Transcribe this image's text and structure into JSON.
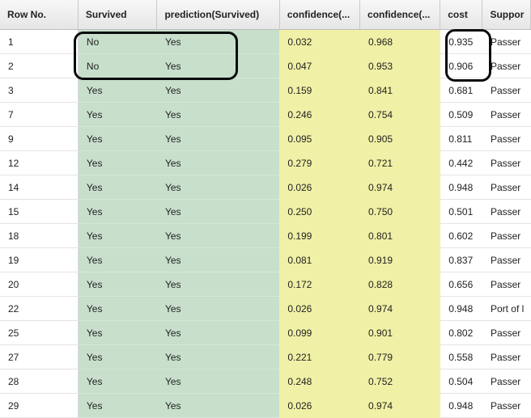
{
  "columns": [
    "Row No.",
    "Survived",
    "prediction(Survived)",
    "confidence(...",
    "confidence(...",
    "cost",
    "Suppor"
  ],
  "rows": [
    {
      "row_no": "1",
      "survived": "No",
      "prediction": "Yes",
      "conf_a": "0.032",
      "conf_b": "0.968",
      "cost": "0.935",
      "support": "Passer"
    },
    {
      "row_no": "2",
      "survived": "No",
      "prediction": "Yes",
      "conf_a": "0.047",
      "conf_b": "0.953",
      "cost": "0.906",
      "support": "Passer"
    },
    {
      "row_no": "3",
      "survived": "Yes",
      "prediction": "Yes",
      "conf_a": "0.159",
      "conf_b": "0.841",
      "cost": "0.681",
      "support": "Passer"
    },
    {
      "row_no": "7",
      "survived": "Yes",
      "prediction": "Yes",
      "conf_a": "0.246",
      "conf_b": "0.754",
      "cost": "0.509",
      "support": "Passer"
    },
    {
      "row_no": "9",
      "survived": "Yes",
      "prediction": "Yes",
      "conf_a": "0.095",
      "conf_b": "0.905",
      "cost": "0.811",
      "support": "Passer"
    },
    {
      "row_no": "12",
      "survived": "Yes",
      "prediction": "Yes",
      "conf_a": "0.279",
      "conf_b": "0.721",
      "cost": "0.442",
      "support": "Passer"
    },
    {
      "row_no": "14",
      "survived": "Yes",
      "prediction": "Yes",
      "conf_a": "0.026",
      "conf_b": "0.974",
      "cost": "0.948",
      "support": "Passer"
    },
    {
      "row_no": "15",
      "survived": "Yes",
      "prediction": "Yes",
      "conf_a": "0.250",
      "conf_b": "0.750",
      "cost": "0.501",
      "support": "Passer"
    },
    {
      "row_no": "18",
      "survived": "Yes",
      "prediction": "Yes",
      "conf_a": "0.199",
      "conf_b": "0.801",
      "cost": "0.602",
      "support": "Passer"
    },
    {
      "row_no": "19",
      "survived": "Yes",
      "prediction": "Yes",
      "conf_a": "0.081",
      "conf_b": "0.919",
      "cost": "0.837",
      "support": "Passer"
    },
    {
      "row_no": "20",
      "survived": "Yes",
      "prediction": "Yes",
      "conf_a": "0.172",
      "conf_b": "0.828",
      "cost": "0.656",
      "support": "Passer"
    },
    {
      "row_no": "22",
      "survived": "Yes",
      "prediction": "Yes",
      "conf_a": "0.026",
      "conf_b": "0.974",
      "cost": "0.948",
      "support": "Port of l"
    },
    {
      "row_no": "25",
      "survived": "Yes",
      "prediction": "Yes",
      "conf_a": "0.099",
      "conf_b": "0.901",
      "cost": "0.802",
      "support": "Passer"
    },
    {
      "row_no": "27",
      "survived": "Yes",
      "prediction": "Yes",
      "conf_a": "0.221",
      "conf_b": "0.779",
      "cost": "0.558",
      "support": "Passer"
    },
    {
      "row_no": "28",
      "survived": "Yes",
      "prediction": "Yes",
      "conf_a": "0.248",
      "conf_b": "0.752",
      "cost": "0.504",
      "support": "Passer"
    },
    {
      "row_no": "29",
      "survived": "Yes",
      "prediction": "Yes",
      "conf_a": "0.026",
      "conf_b": "0.974",
      "cost": "0.948",
      "support": "Passer"
    }
  ],
  "colors": {
    "label_columns_bg": "#c7dfcb",
    "confidence_columns_bg": "#f0f0a6",
    "annotation_outline": "#0a0a0a"
  }
}
